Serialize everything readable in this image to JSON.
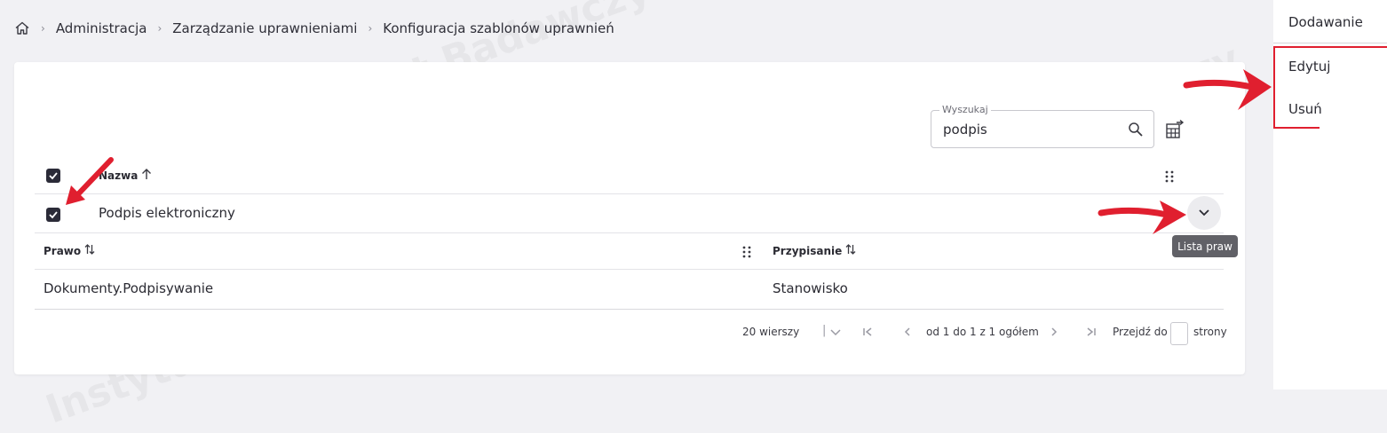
{
  "breadcrumb": {
    "home_icon": "home-icon",
    "items": [
      "Administracja",
      "Zarządzanie uprawnieniami",
      "Konfiguracja szablonów uprawnień"
    ]
  },
  "search": {
    "label": "Wyszukaj",
    "value": "podpis"
  },
  "table": {
    "header": {
      "name": "Nazwa"
    },
    "rows": [
      {
        "name": "Podpis elektroniczny",
        "checked": true
      }
    ],
    "header_checked": true
  },
  "subtable": {
    "columns": [
      "Prawo",
      "Przypisanie"
    ],
    "rows": [
      {
        "prawo": "Dokumenty.Podpisywanie",
        "przypisanie": "Stanowisko"
      }
    ]
  },
  "tooltip": "Lista praw",
  "pagination": {
    "rows_per_page": "20 wierszy",
    "range": "od 1 do 1 z 1 ogółem",
    "goto_label": "Przejdź do",
    "goto_suffix": "strony"
  },
  "side_menu": {
    "items": [
      "Dodawanie",
      "Edytuj",
      "Usuń"
    ]
  },
  "colors": {
    "annotation_red": "#e01f2f",
    "checkbox": "#2b2b38",
    "tooltip_bg": "#616167"
  }
}
